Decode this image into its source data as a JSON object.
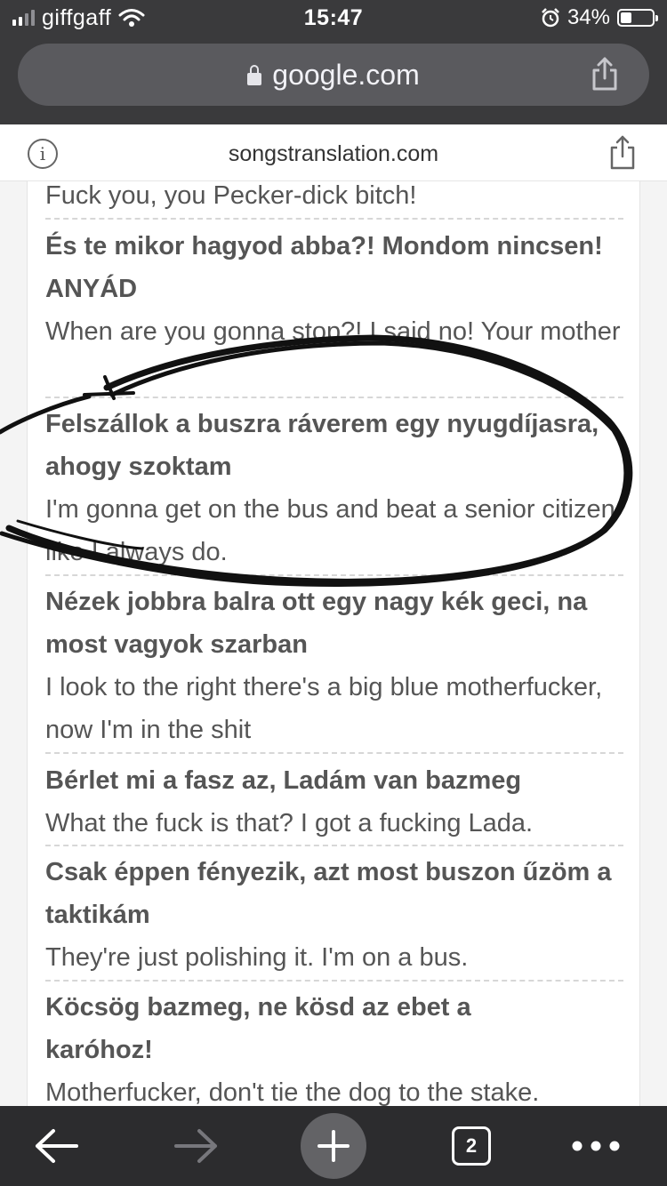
{
  "status_bar": {
    "carrier": "giffgaff",
    "time": "15:47",
    "battery_percent": "34%",
    "battery_level": 0.34,
    "signal_bars": 2,
    "icons": [
      "wifi-icon",
      "alarm-icon",
      "battery-icon"
    ]
  },
  "browser": {
    "url": "google.com",
    "amp_domain": "songstranslation.com",
    "tab_count": "2"
  },
  "lyrics": [
    {
      "hungarian": "",
      "english": "Fuck you, you Pecker-dick bitch!"
    },
    {
      "hungarian": "És te mikor hagyod abba?! Mondom nincsen! ANYÁD",
      "english": "When are you gonna stop?! I said no! Your mother"
    },
    {
      "hungarian": "Felszállok a buszra ráverem egy nyugdíjasra, ahogy szoktam",
      "english": "I'm gonna get on the bus and beat a senior citizen like I always do."
    },
    {
      "hungarian": "Nézek jobbra balra ott egy nagy kék geci, na most vagyok szarban",
      "english": "I look to the right there's a big blue motherfucker, now I'm in the shit"
    },
    {
      "hungarian": "Bérlet mi a fasz az, Ladám van bazmeg",
      "english": "What the fuck is that? I got a fucking Lada."
    },
    {
      "hungarian": "Csak éppen fényezik, azt most buszon űzöm a taktikám",
      "english": "They're just polishing it. I'm on a bus."
    },
    {
      "hungarian": "Köcsög bazmeg, ne kösd az ebet a karóhoz!",
      "english": "Motherfucker, don't tie the dog to the stake."
    }
  ],
  "colors": {
    "chrome_dark": "#3a3a3c",
    "url_pill": "#5a5a5e",
    "toolbar": "#2c2c2e",
    "lyric_text": "#555555",
    "scribble": "#111111"
  }
}
